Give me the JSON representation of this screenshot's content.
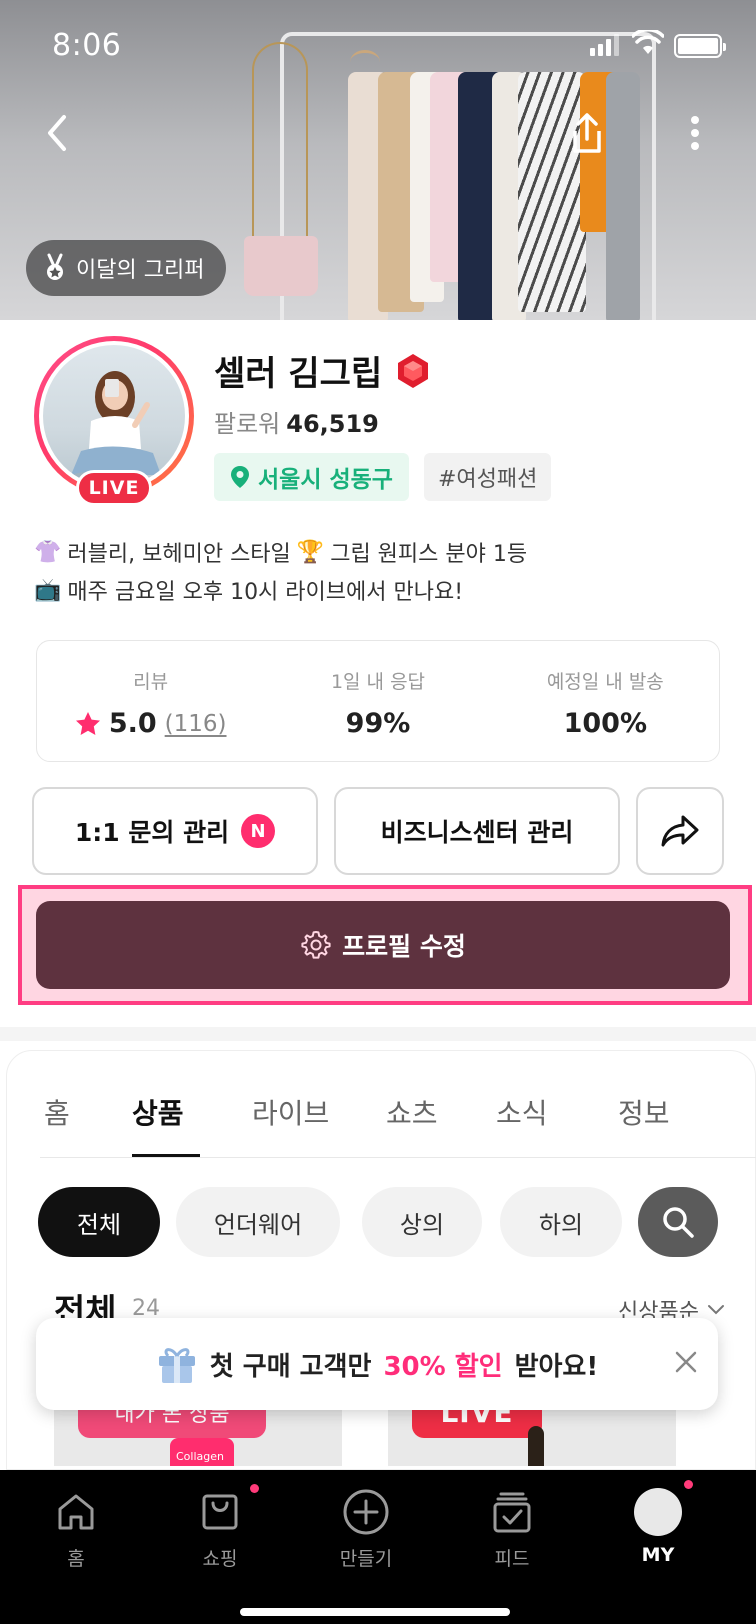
{
  "status_bar": {
    "time": "8:06"
  },
  "banner": {
    "month_badge": "이달의 그리퍼"
  },
  "profile": {
    "name": "셀러 김그립",
    "followers_label": "팔로워",
    "followers_count": "46,519",
    "live_label": "LIVE",
    "location": "서울시 성동구",
    "tag": "#여성패션"
  },
  "bio": [
    {
      "emoji": "👚",
      "text": "러블리, 보헤미안 스타일",
      "emoji2": "🏆",
      "text2": "그립 원피스 분야 1등"
    },
    {
      "emoji": "📺",
      "text": "매주 금요일 오후 10시 라이브에서 만나요!"
    }
  ],
  "stats": [
    {
      "label": "리뷰",
      "value": "5.0",
      "count": "(116)"
    },
    {
      "label": "1일 내 응답",
      "value": "99%"
    },
    {
      "label": "예정일 내 발송",
      "value": "100%"
    }
  ],
  "actions": {
    "inquiry": "1:1 문의 관리",
    "inquiry_badge": "N",
    "business": "비즈니스센터 관리",
    "edit_profile": "프로필 수정"
  },
  "tabs": [
    "홈",
    "상품",
    "라이브",
    "쇼츠",
    "소식",
    "정보"
  ],
  "filters": [
    "전체",
    "언더웨어",
    "상의",
    "하의"
  ],
  "list": {
    "title": "전체",
    "count": "24",
    "sort": "신상품순"
  },
  "cards": [
    {
      "tag": "내가 본 상품",
      "product_text": "Collagen"
    },
    {
      "tag": "LIVE"
    }
  ],
  "toast": {
    "prefix": "첫 구매 고객만",
    "highlight": "30% 할인",
    "suffix": "받아요!"
  },
  "bottom_nav": [
    "홈",
    "쇼핑",
    "만들기",
    "피드",
    "MY"
  ],
  "colors": {
    "accent": "#ff2d7a",
    "edit_button": "#5e323f",
    "location": "#18b07a",
    "live": "#ee2e45"
  }
}
